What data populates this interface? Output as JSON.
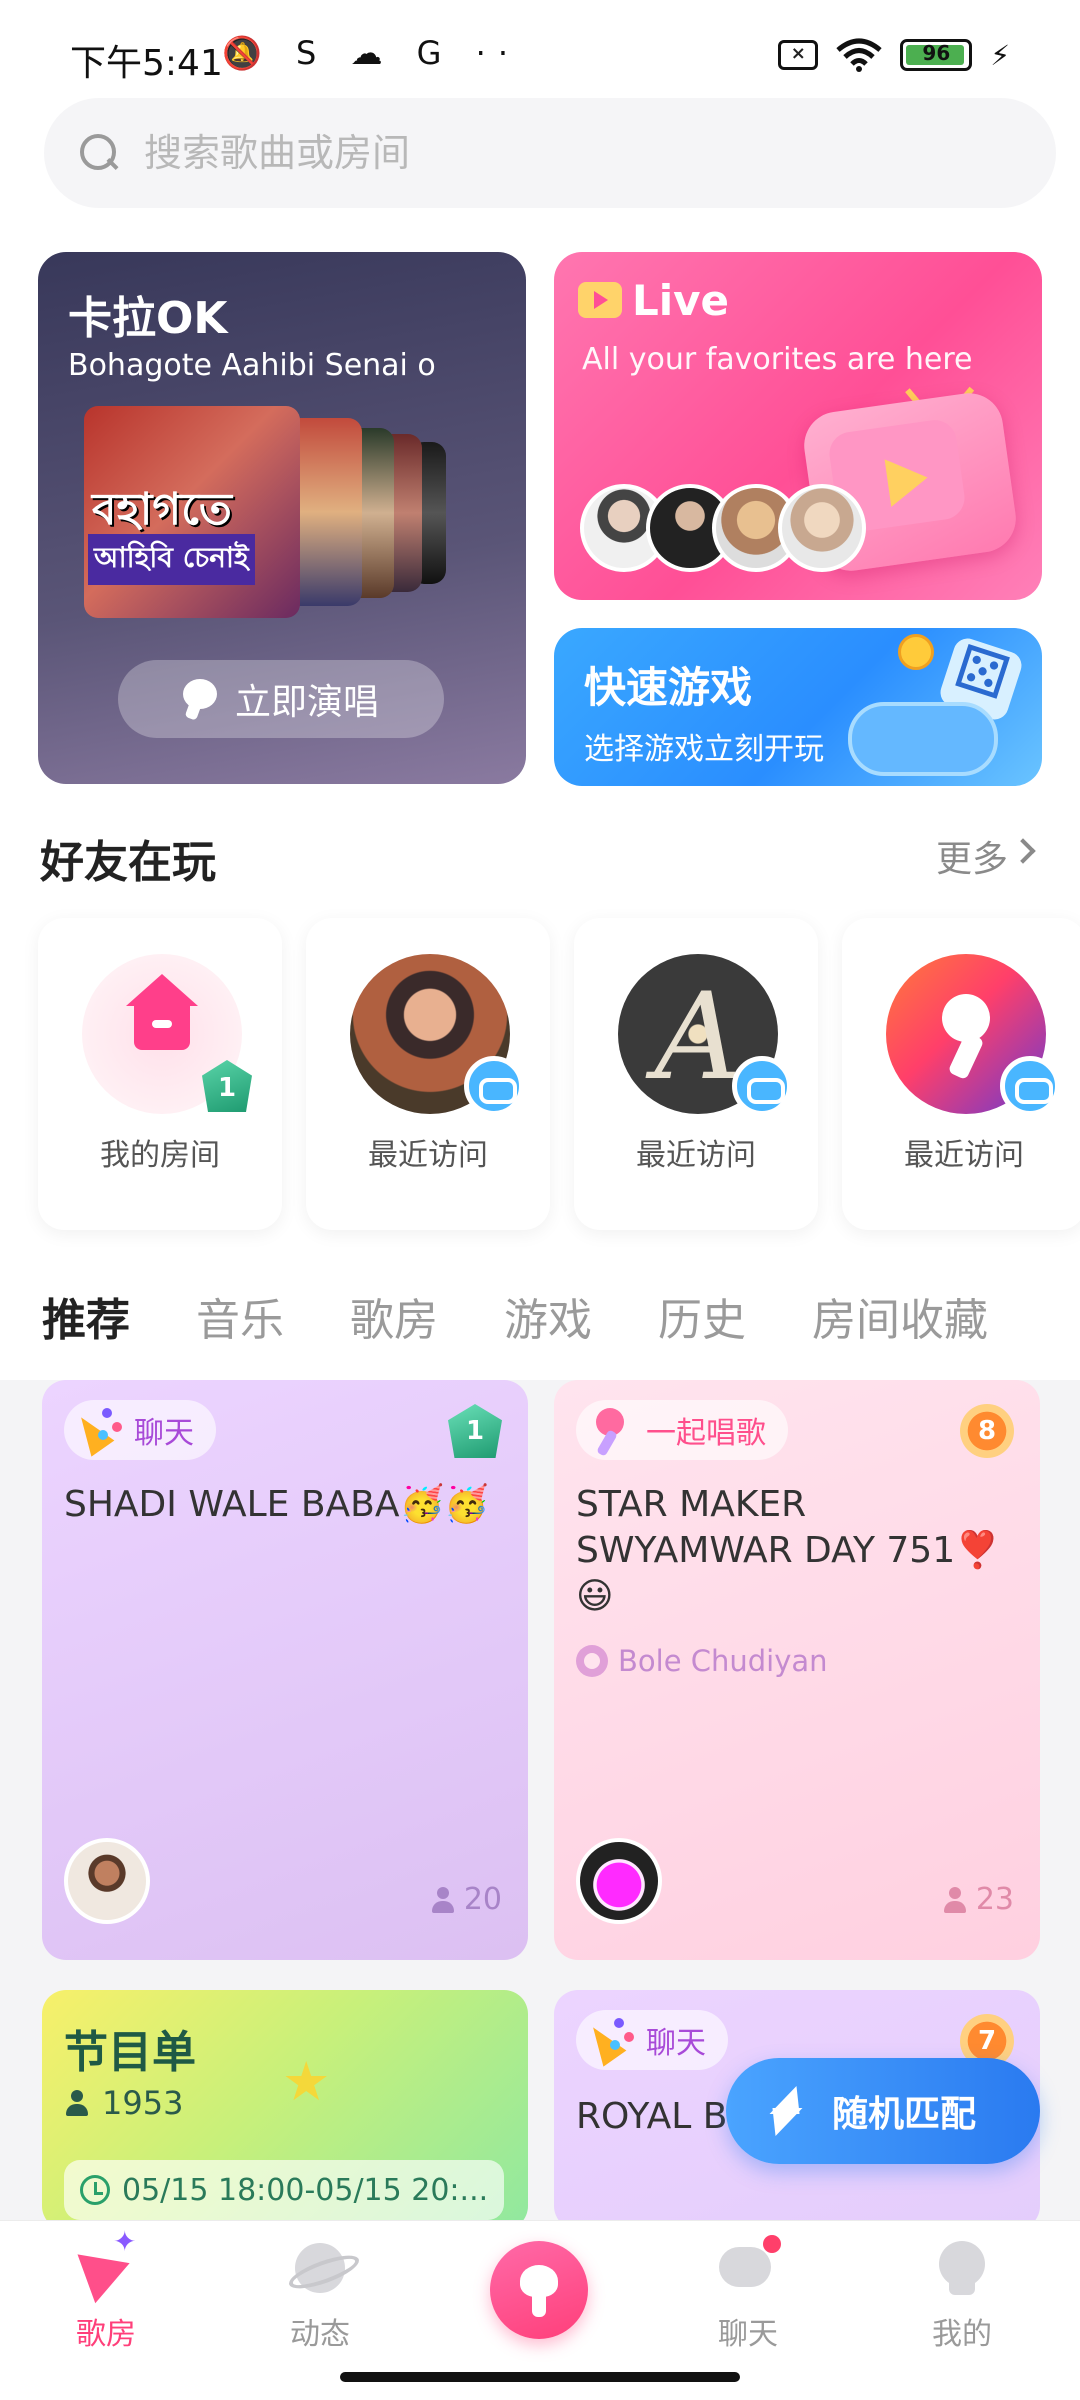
{
  "status_bar": {
    "time": "下午5:41",
    "icons_left": "🔕 S ☁ G ··",
    "battery": "96",
    "battery_level": 0.96
  },
  "search": {
    "placeholder": "搜索歌曲或房间"
  },
  "karaoke_card": {
    "title": "卡拉OK",
    "subtitle": "Bohagote Aahibi Senai o",
    "album_text_1": "বহাগতে",
    "album_text_2": "আহিবি চেনাই",
    "button_label": "立即演唱"
  },
  "live_card": {
    "title": "Live",
    "subtitle": "All your favorites are here"
  },
  "quick_game_card": {
    "title": "快速游戏",
    "subtitle": "选择游戏立刻开玩"
  },
  "friends": {
    "title": "好友在玩",
    "more": "更多",
    "items": [
      {
        "label": "我的房间",
        "badge": "1"
      },
      {
        "label": "最近访问"
      },
      {
        "label": "最近访问",
        "avatar_letter": "A"
      },
      {
        "label": "最近访问"
      }
    ]
  },
  "tabs": [
    "推荐",
    "音乐",
    "歌房",
    "游戏",
    "历史",
    "房间收藏"
  ],
  "rooms": [
    {
      "tag": "聊天",
      "badge": "1",
      "title": "SHADI WALE BABA🥳🥳",
      "count": "20"
    },
    {
      "tag": "一起唱歌",
      "badge": "8",
      "title": "STAR MAKER SWYAMWAR DAY 751❣️😃",
      "song": "Bole Chudiyan",
      "count": "23"
    },
    {
      "title": "节目单",
      "count": "1953",
      "time": "05/15 18:00-05/15 20:..."
    },
    {
      "tag": "聊天",
      "badge": "7",
      "title": "ROYAL B... BHAWAN 😃"
    }
  ],
  "fab": {
    "label": "随机匹配"
  },
  "bottom_nav": [
    {
      "label": "歌房",
      "icon": "room-icon",
      "active": true
    },
    {
      "label": "动态",
      "icon": "planet-icon"
    },
    {
      "label": "",
      "icon": "mic-center-icon"
    },
    {
      "label": "聊天",
      "icon": "chat-icon"
    },
    {
      "label": "我的",
      "icon": "profile-icon"
    }
  ],
  "colors": {
    "accent": "#ff3f7a",
    "live_gradient": "#ff4f96",
    "game_blue": "#2a8eff",
    "fab_blue": "#2a7af0"
  }
}
